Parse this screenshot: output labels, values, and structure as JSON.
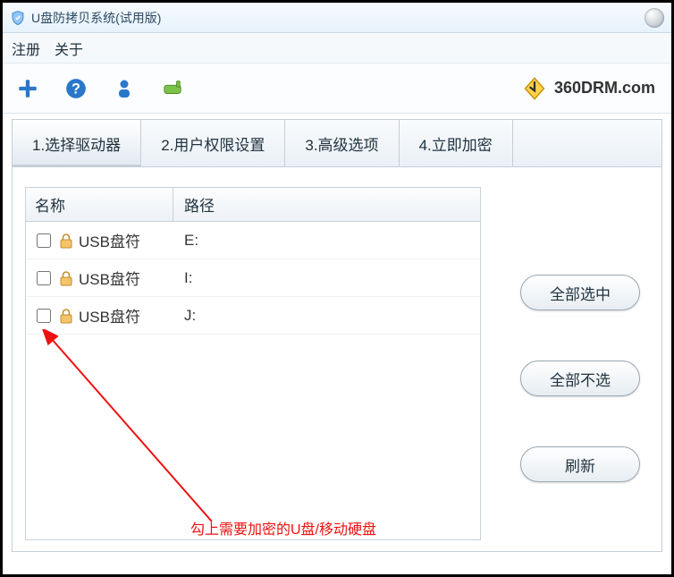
{
  "window": {
    "title": "U盘防拷贝系统(试用版)"
  },
  "menu": {
    "register": "注册",
    "about": "关于"
  },
  "brand": {
    "text": "360DRM.com"
  },
  "tabs": [
    {
      "label": "1.选择驱动器",
      "active": true
    },
    {
      "label": "2.用户权限设置",
      "active": false
    },
    {
      "label": "3.高级选项",
      "active": false
    },
    {
      "label": "4.立即加密",
      "active": false
    }
  ],
  "list": {
    "headers": {
      "name": "名称",
      "path": "路径"
    },
    "rows": [
      {
        "name": "USB盘符",
        "path": "E:"
      },
      {
        "name": "USB盘符",
        "path": "I:"
      },
      {
        "name": "USB盘符",
        "path": "J:"
      }
    ]
  },
  "buttons": {
    "select_all": "全部选中",
    "select_none": "全部不选",
    "refresh": "刷新"
  },
  "annotation": {
    "text": "勾上需要加密的U盘/移动硬盘"
  }
}
